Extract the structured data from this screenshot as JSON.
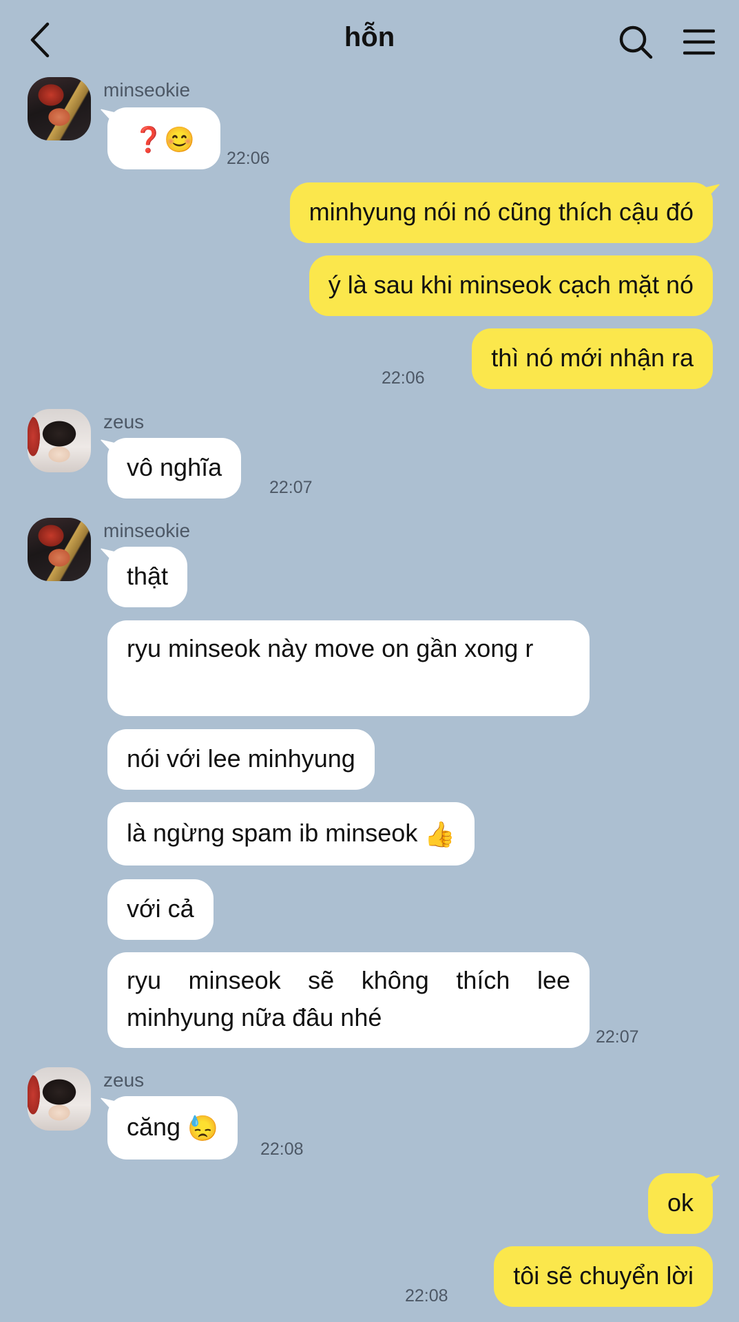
{
  "header": {
    "title": "hỗn"
  },
  "senders": {
    "minseokie": "minseokie",
    "zeus": "zeus"
  },
  "messages": {
    "m1": {
      "text": "❓😊",
      "time": "22:06"
    },
    "o1": {
      "text": "minhyung nói nó cũng thích cậu đó"
    },
    "o2": {
      "text": "ý là sau khi minseok cạch mặt nó"
    },
    "o3": {
      "text": "thì nó mới nhận ra",
      "time": "22:06"
    },
    "z1": {
      "text": "vô nghĩa",
      "time": "22:07"
    },
    "m2": {
      "text": "thật"
    },
    "m3": {
      "text": "ryu minseok này move on gần xong r"
    },
    "m4": {
      "text": "nói với lee minhyung"
    },
    "m5": {
      "text": "là ngừng spam ib minseok",
      "emoji": "👍"
    },
    "m6": {
      "text": "với cả"
    },
    "m7": {
      "text": "ryu minseok sẽ không thích lee minhyung nữa đâu nhé",
      "time": "22:07"
    },
    "z2": {
      "text": "căng",
      "emoji": "😓",
      "time": "22:08"
    },
    "o4": {
      "text": "ok"
    },
    "o5": {
      "text": "tôi sẽ chuyển lời",
      "time": "22:08"
    }
  },
  "icons": {
    "back": "chevron-left-icon",
    "search": "search-icon",
    "menu": "hamburger-menu-icon"
  },
  "colors": {
    "background": "#acbfd1",
    "incoming_bubble": "#ffffff",
    "outgoing_bubble": "#fbe74c",
    "meta_text": "#4d5866"
  }
}
